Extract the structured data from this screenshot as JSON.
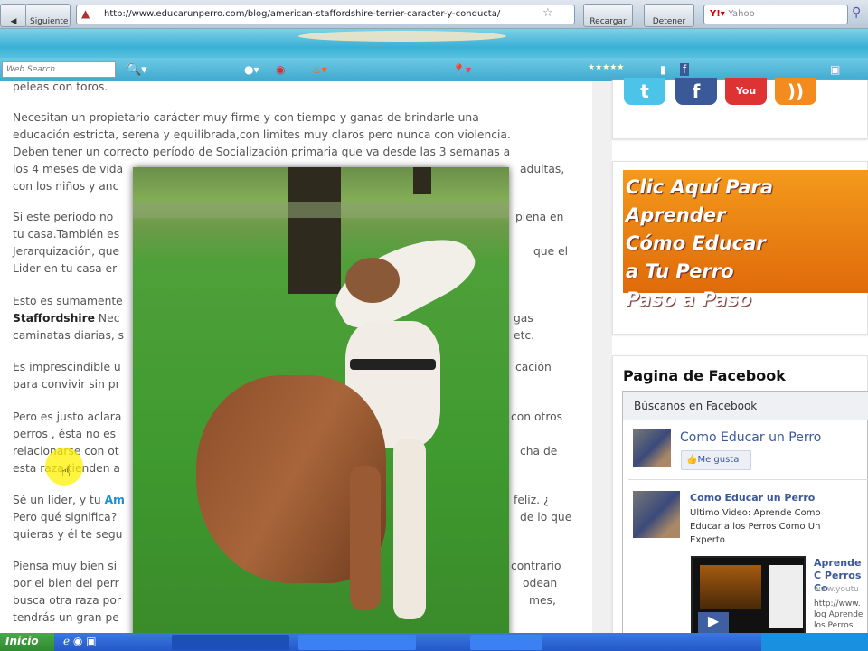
{
  "browser": {
    "back_label": "Siguiente",
    "url": "http://www.educarunperro.com/blog/american-staffordshire-terrier-caracter-y-conducta/",
    "reload_label": "Recargar",
    "stop_label": "Detener",
    "search_engine": "Yahoo",
    "web_search_placeholder": "Web Search"
  },
  "article": {
    "lines": [
      "peleas con toros.",
      "Necesitan un propietario carácter  muy firme y con tiempo y ganas de brindarle una",
      "educación estricta, serena y equilibrada,con limites muy claros pero nunca con violencia.",
      "Deben tener un correcto período de Socialización primaria que va desde las 3 semanas a",
      "los 4 meses de vida",
      "adultas,",
      "con los niños y anc",
      "Si este período no",
      "plena en",
      "tu casa.También es",
      "Jerarquización, que",
      "que el",
      "Lider en tu casa er",
      "Esto es sumamente",
      "Staffordshire",
      " Nec",
      "gas",
      "caminatas diarias, s",
      "etc.",
      "Es imprescindible u",
      "cación",
      "para convivir sin pr",
      "Pero es justo aclara",
      "con otros",
      "perros , ésta no es",
      "relacionarse con ot",
      "cha de",
      "esta raza tienden a",
      "Sé un líder, y tu ",
      "Am",
      "feliz. ¿",
      "Pero qué significa?",
      "de lo que",
      "quieras y él te segu",
      "Piensa muy bien si",
      "contrario",
      "por el bien del perr",
      "odean",
      "busca otra raza por",
      "mes,",
      "tendrás un gran pe"
    ]
  },
  "sidebar": {
    "social": [
      "twitter",
      "facebook",
      "youtube",
      "rss"
    ],
    "banner_lines": [
      "Clic Aquí Para Aprender",
      "Cómo Educar",
      "a Tu Perro",
      "Paso a Paso"
    ],
    "facebook_title": "Pagina de Facebook",
    "facebook_header": "Búscanos en Facebook",
    "page_name": "Como Educar un Perro",
    "like_label": "Me gusta",
    "post_author": "Como Educar un Perro",
    "post_text": "Ultimo Video: Aprende Como Educar a los Perros Como Un Experto",
    "video_title": "Aprende C Perros Co",
    "video_site": "www.youtu",
    "video_desc": "http://www. log Aprende los Perros"
  },
  "taskbar": {
    "start_label": "Inicio"
  }
}
